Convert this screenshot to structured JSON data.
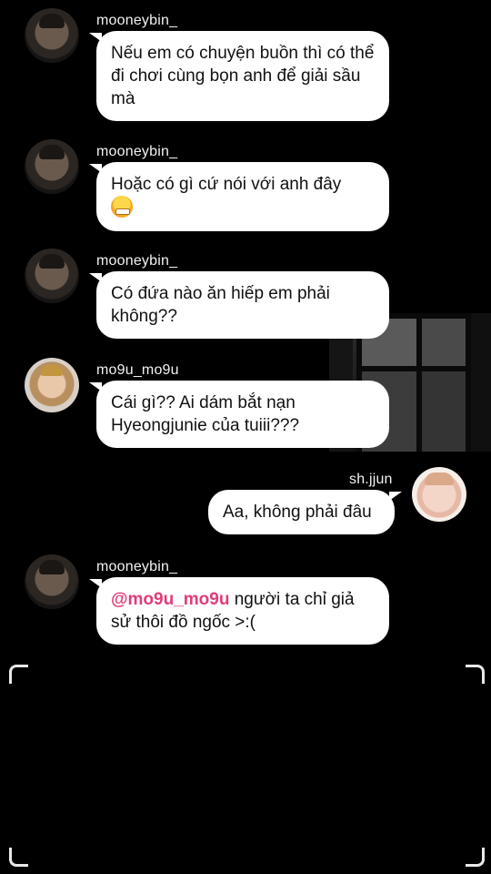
{
  "messages": [
    {
      "user": "mooneybin_",
      "text": "Nếu em có chuyện buồn thì có thể đi chơi cùng bọn anh để giải sầu mà"
    },
    {
      "user": "mooneybin_",
      "text": "Hoặc có gì cứ nói với anh đây"
    },
    {
      "user": "mooneybin_",
      "text": "Có đứa nào ăn hiếp em phải không??"
    },
    {
      "user": "mo9u_mo9u",
      "text": "Cái gì?? Ai dám bắt nạn Hyeongjunie của tuiii???"
    },
    {
      "user": "sh.jjun",
      "text": "Aa, không phải đâu"
    },
    {
      "user": "mooneybin_",
      "mention": "@mo9u_mo9u",
      "text": " người ta chỉ giả sử thôi đồ ngốc >:("
    }
  ],
  "icons": {
    "emoji": "angry-face-emoji",
    "corners": "viewfinder-corners"
  },
  "colors": {
    "background": "#000000",
    "bubble": "#ffffff",
    "mention": "#e23c7a"
  }
}
